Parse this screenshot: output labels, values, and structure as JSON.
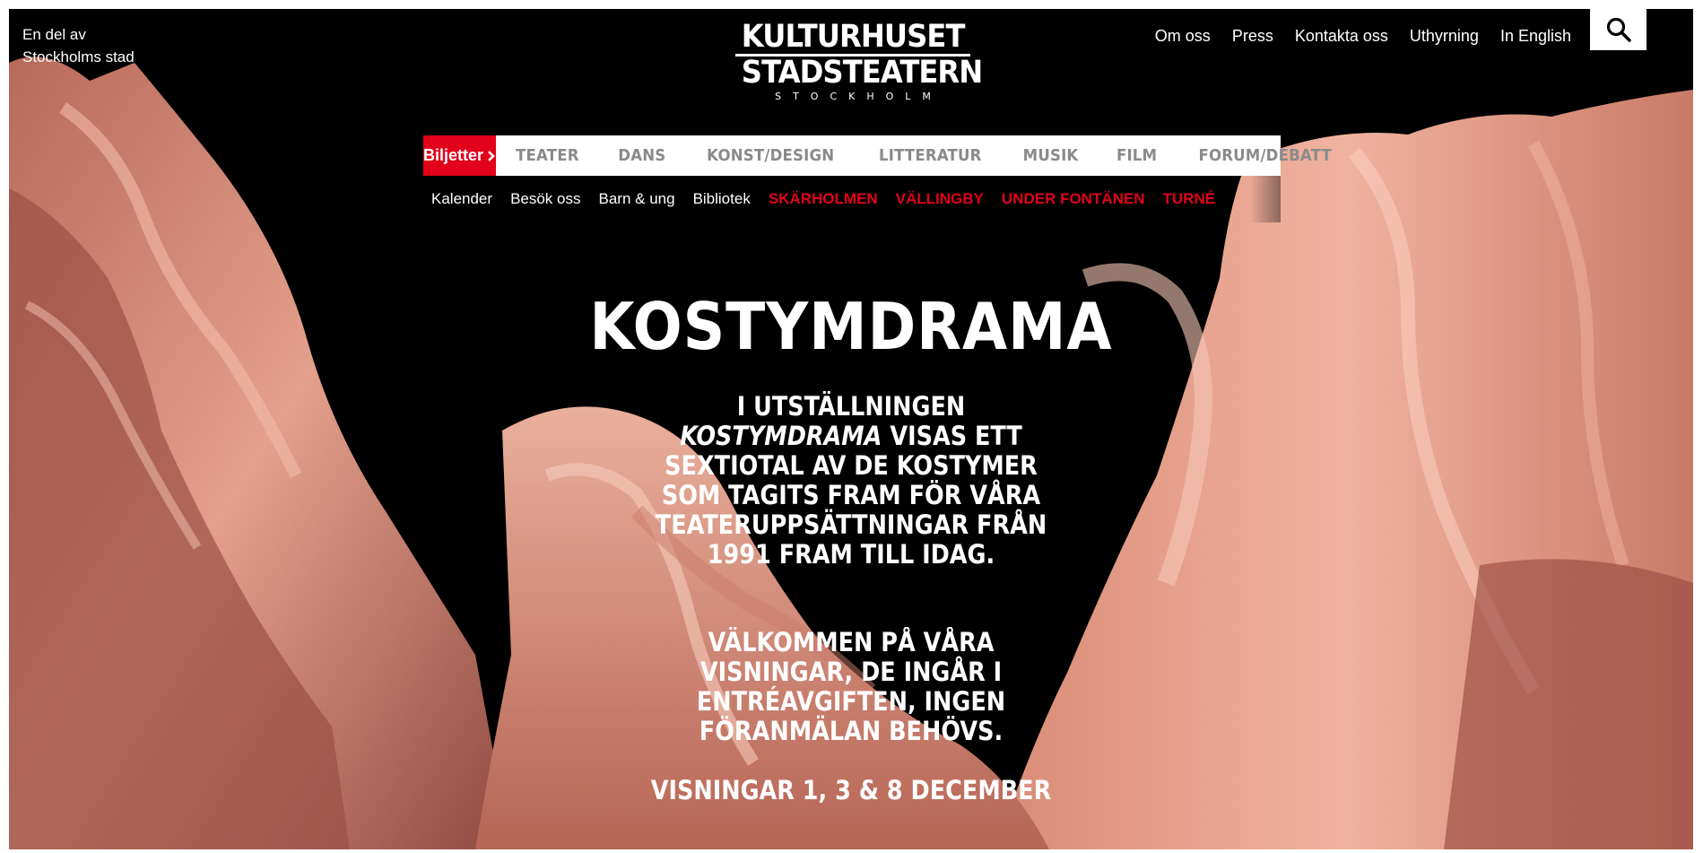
{
  "header": {
    "city_note": "En del av Stockholms stad",
    "logo": {
      "line1": "KULTURHUSET",
      "line2": "STADSTEATERN",
      "line3": "STOCKHOLM"
    },
    "utility_nav": [
      "Om oss",
      "Press",
      "Kontakta oss",
      "Uthyrning",
      "In English"
    ],
    "search_icon": "search-icon"
  },
  "main_nav": {
    "tickets_label": "Biljetter",
    "tickets_icon": "chevron-right-icon",
    "items": [
      "TEATER",
      "DANS",
      "KONST/DESIGN",
      "LITTERATUR",
      "MUSIK",
      "FILM",
      "FORUM/DEBATT"
    ]
  },
  "sub_nav": {
    "items": [
      "Kalender",
      "Besök oss",
      "Barn & ung",
      "Bibliotek"
    ],
    "red_items": [
      "SKÄRHOLMEN",
      "VÄLLINGBY",
      "UNDER FONTÄNEN",
      "TURNÉ"
    ]
  },
  "hero": {
    "title": "KOSTYMDRAMA",
    "intro_prefix": "I utställningen",
    "intro_em": "Kostymdrama",
    "intro_suffix": "visas ett sextiotal av de kostymer som tagits fram för våra teateruppsättningar från 1991 fram till idag.",
    "welcome": "Välkommen på våra visningar, de ingår i entréavgiften, ingen föranmälan behövs.",
    "dates": "Visningar 1, 3 & 8 december"
  },
  "colors": {
    "accent_red": "#e2001a",
    "background": "#000000",
    "fabric": "#e8a491",
    "nav_gray": "#8a8a8a"
  }
}
